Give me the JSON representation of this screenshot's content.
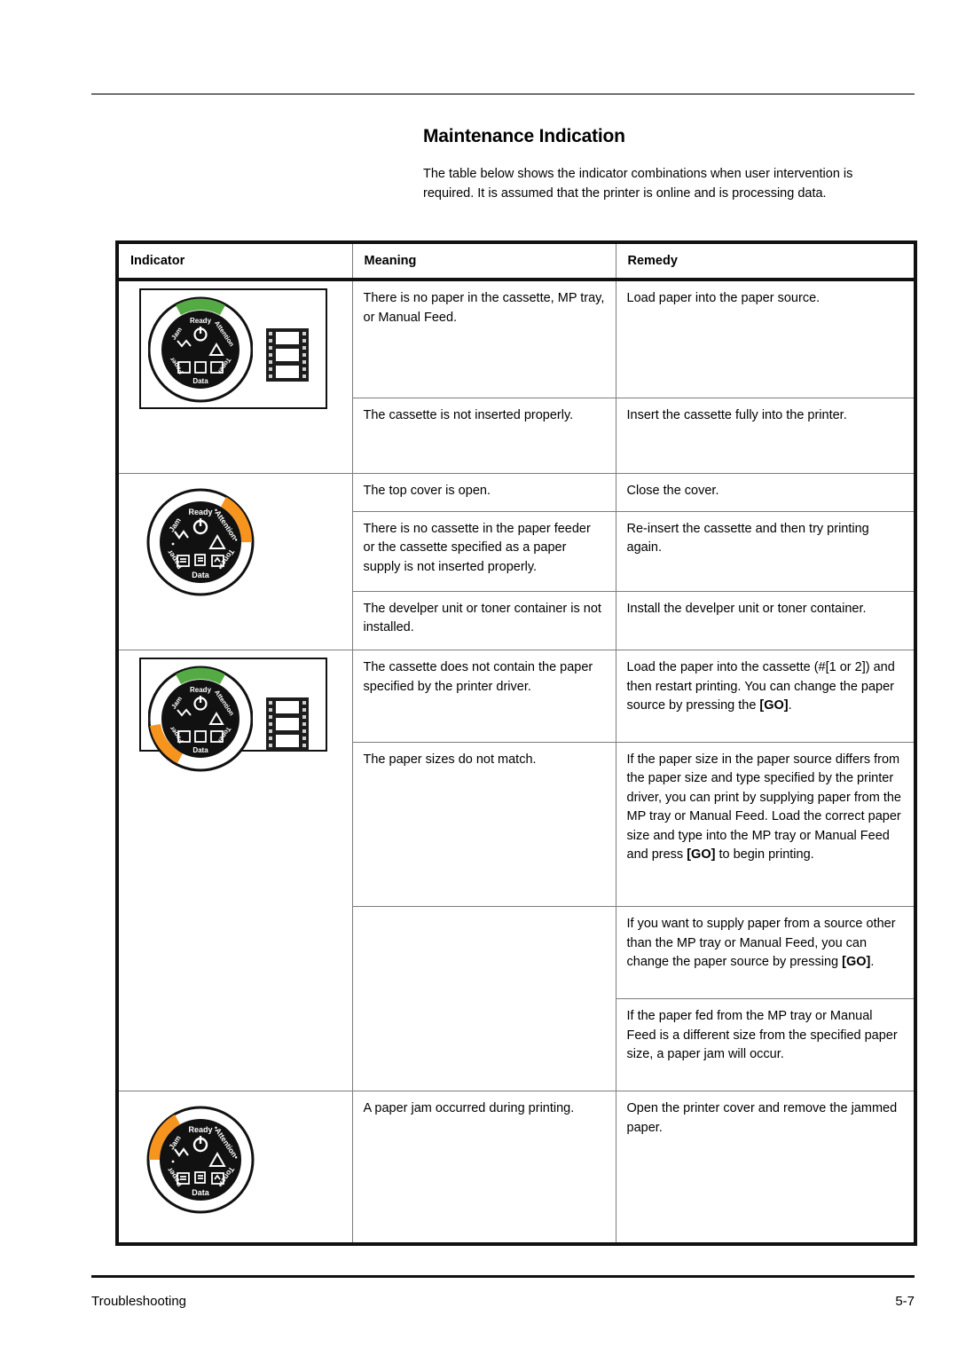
{
  "header": {
    "title": "Maintenance Indication",
    "intro": "The table below shows the indicator combinations when user intervention is required. It is assumed that the printer is online and is processing data."
  },
  "table": {
    "columns": [
      "Indicator",
      "Meaning",
      "Remedy"
    ],
    "rows": [
      {
        "indicator": {
          "type": "panel-with-filmstrip",
          "dial_lit": [
            "Ready"
          ],
          "lit_colors": {
            "Ready": "#54ab44"
          }
        },
        "entries": [
          {
            "meaning": "There is no paper in the cassette, MP tray, or Manual Feed.",
            "remedy": "Load paper into the paper source."
          },
          {
            "meaning": "The cassette is not inserted properly.",
            "remedy": "Insert the cassette fully into the printer."
          }
        ]
      },
      {
        "indicator": {
          "type": "dial-only",
          "dial_lit": [
            "Attention"
          ],
          "lit_colors": {
            "Attention": "#f7941e"
          }
        },
        "entries": [
          {
            "meaning": "The top cover is open.",
            "remedy": "Close the cover."
          },
          {
            "meaning": "There is no cassette in the paper feeder or the cassette specified as a paper supply is not inserted properly.",
            "remedy": "Re-insert the cassette and then try printing again."
          },
          {
            "meaning": "The develper unit or toner container is not installed.",
            "remedy": "Install the develper unit or toner container."
          }
        ]
      },
      {
        "indicator": {
          "type": "panel-with-filmstrip",
          "dial_lit": [
            "Ready",
            "Paper"
          ],
          "lit_colors": {
            "Ready": "#54ab44",
            "Paper": "#f7941e"
          }
        },
        "entries": [
          {
            "meaning": "The cassette does not contain the paper specified by the printer driver.",
            "remedy_parts": [
              {
                "t": "Load the paper into the cassette (#[1 or 2]) and then restart printing. You can change the paper source by pressing the "
              },
              {
                "t": "[GO]",
                "bold": true
              },
              {
                "t": "."
              }
            ]
          },
          {
            "meaning": "The paper sizes do not match.",
            "remedy_parts": [
              {
                "t": "If the paper size in the paper source differs from the paper size and type specified by the printer driver, you can print by supplying paper from the MP tray or Manual Feed. Load the correct paper size and type into the MP tray or Manual Feed and press "
              },
              {
                "t": "[GO]",
                "bold": true
              },
              {
                "t": " to begin printing."
              }
            ]
          },
          {
            "meaning": "",
            "remedy_parts": [
              {
                "t": "If you want to supply paper from a source other than the MP tray or Manual Feed, you can change the paper source by pressing "
              },
              {
                "t": "[GO]",
                "bold": true
              },
              {
                "t": "."
              }
            ]
          },
          {
            "meaning": "",
            "remedy": "If the paper fed from the MP tray or Manual Feed is a different size from the specified paper size, a paper jam will occur."
          }
        ]
      },
      {
        "indicator": {
          "type": "dial-only",
          "dial_lit": [
            "Jam"
          ],
          "lit_colors": {
            "Jam": "#f7941e"
          }
        },
        "entries": [
          {
            "meaning": "A paper jam occurred during printing.",
            "remedy": "Open the printer cover and remove the jammed paper."
          }
        ]
      }
    ]
  },
  "dial_labels": [
    "Ready",
    "Attention",
    "Toner",
    "Data",
    "Paper",
    "Jam"
  ],
  "footer": {
    "left": "Troubleshooting",
    "right": "5-7"
  }
}
